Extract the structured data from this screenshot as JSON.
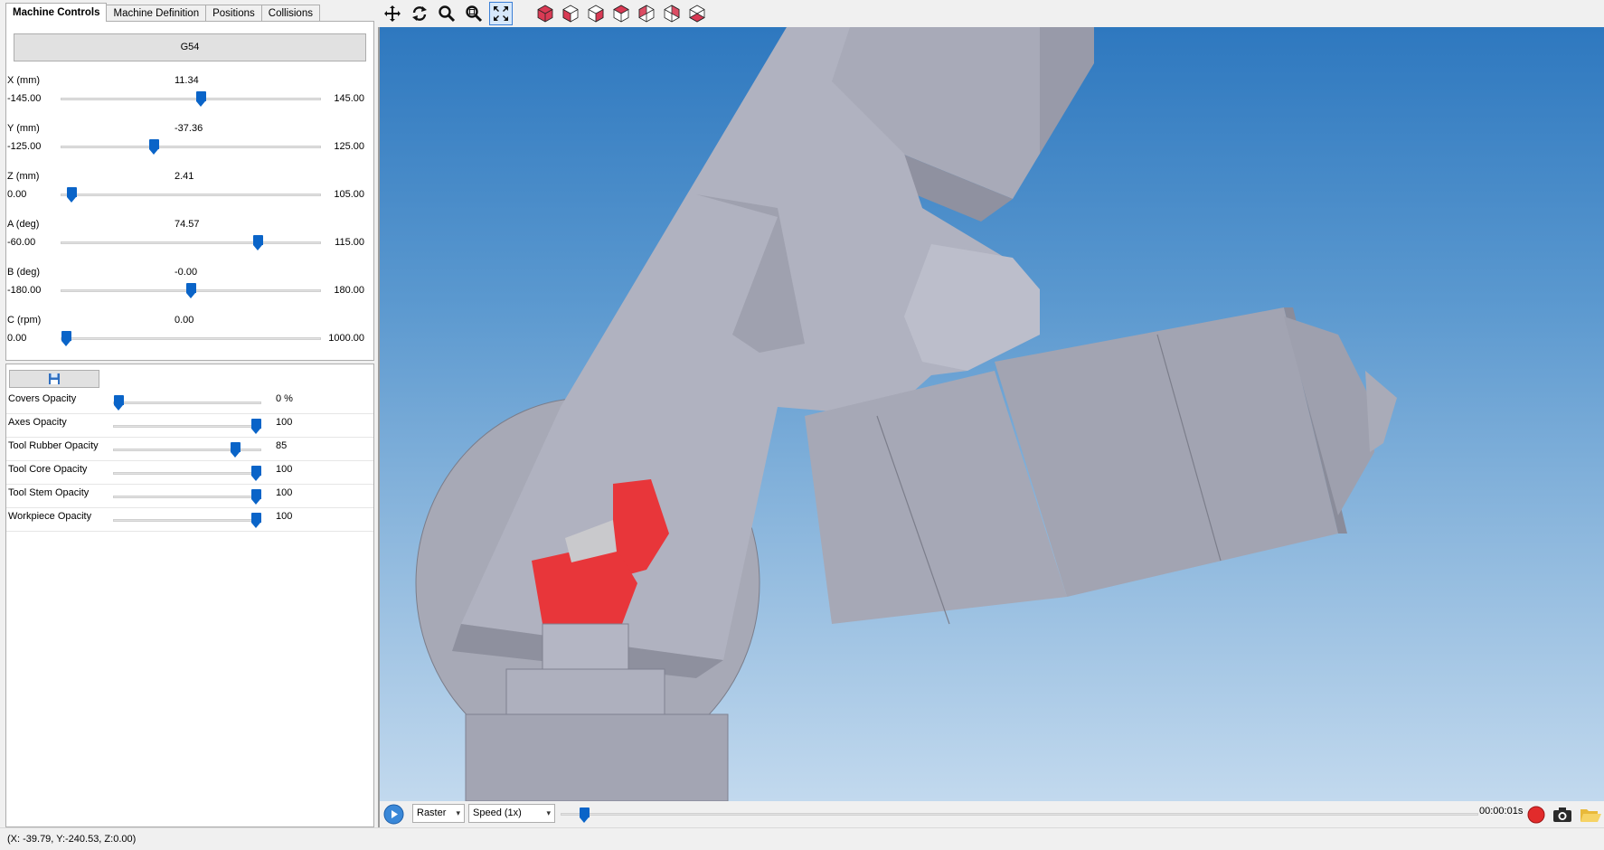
{
  "tabs": [
    {
      "label": "Machine Controls",
      "active": true
    },
    {
      "label": "Machine Definition",
      "active": false
    },
    {
      "label": "Positions",
      "active": false
    },
    {
      "label": "Collisions",
      "active": false
    }
  ],
  "wcs_label": "G54",
  "axes": [
    {
      "name": "X (mm)",
      "value": "11.34",
      "min": "-145.00",
      "max": "145.00",
      "fraction": 0.539
    },
    {
      "name": "Y (mm)",
      "value": "-37.36",
      "min": "-125.00",
      "max": "125.00",
      "fraction": 0.35
    },
    {
      "name": "Z (mm)",
      "value": "2.41",
      "min": "0.00",
      "max": "105.00",
      "fraction": 0.023
    },
    {
      "name": "A (deg)",
      "value": "74.57",
      "min": "-60.00",
      "max": "115.00",
      "fraction": 0.769
    },
    {
      "name": "B (deg)",
      "value": "-0.00",
      "min": "-180.00",
      "max": "180.00",
      "fraction": 0.5
    },
    {
      "name": "C (rpm)",
      "value": "0.00",
      "min": "0.00",
      "max": "1000.00",
      "fraction": 0.0
    }
  ],
  "opacity": [
    {
      "label": "Covers Opacity",
      "value": "0 %",
      "fraction": 0.0
    },
    {
      "label": "Axes Opacity",
      "value": "100",
      "fraction": 1.0
    },
    {
      "label": "Tool Rubber Opacity",
      "value": "85",
      "fraction": 0.85
    },
    {
      "label": "Tool Core Opacity",
      "value": "100",
      "fraction": 1.0
    },
    {
      "label": "Tool Stem Opacity",
      "value": "100",
      "fraction": 1.0
    },
    {
      "label": "Workpiece Opacity",
      "value": "100",
      "fraction": 1.0
    }
  ],
  "toolbar": {
    "icons": [
      "pan-icon",
      "rotate-icon",
      "zoom-icon",
      "zoom-window-icon",
      "fit-view-icon"
    ],
    "views": [
      "view-iso-icon",
      "view-front-icon",
      "view-back-icon",
      "view-left-icon",
      "view-right-icon",
      "view-top-icon",
      "view-bottom-icon"
    ]
  },
  "playback": {
    "mode": "Raster",
    "speed": "Speed (1x)",
    "time": "00:00:01s",
    "progress": 0.02
  },
  "status_text": "(X: -39.79, Y:-240.53, Z:0.00)",
  "colors": {
    "accent": "#0a64c8",
    "tool_red": "#e8363a",
    "machine_gray": "#a6a8b6"
  }
}
